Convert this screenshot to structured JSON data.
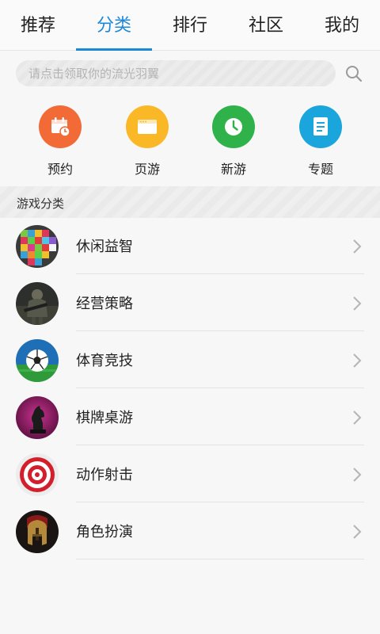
{
  "tabs": [
    {
      "label": "推荐"
    },
    {
      "label": "分类",
      "active": true
    },
    {
      "label": "排行"
    },
    {
      "label": "社区"
    },
    {
      "label": "我的"
    }
  ],
  "search": {
    "placeholder": "请点击领取你的流光羽翼"
  },
  "quick_entries": [
    {
      "label": "预约",
      "icon": "calendar-clock-icon",
      "color": "#f26a35"
    },
    {
      "label": "页游",
      "icon": "browser-window-icon",
      "color": "#fbb826"
    },
    {
      "label": "新游",
      "icon": "clock-icon",
      "color": "#2eb249"
    },
    {
      "label": "专题",
      "icon": "document-icon",
      "color": "#1aa6dc"
    }
  ],
  "section": {
    "title": "游戏分类"
  },
  "categories": [
    {
      "name": "休闲益智",
      "icon": "pixel-puzzle-icon"
    },
    {
      "name": "经营策略",
      "icon": "soldier-icon"
    },
    {
      "name": "体育竞技",
      "icon": "soccer-ball-icon"
    },
    {
      "name": "棋牌桌游",
      "icon": "chess-knight-icon"
    },
    {
      "name": "动作射击",
      "icon": "target-icon"
    },
    {
      "name": "角色扮演",
      "icon": "spartan-helmet-icon"
    }
  ],
  "colors": {
    "accent": "#1e88d8"
  }
}
